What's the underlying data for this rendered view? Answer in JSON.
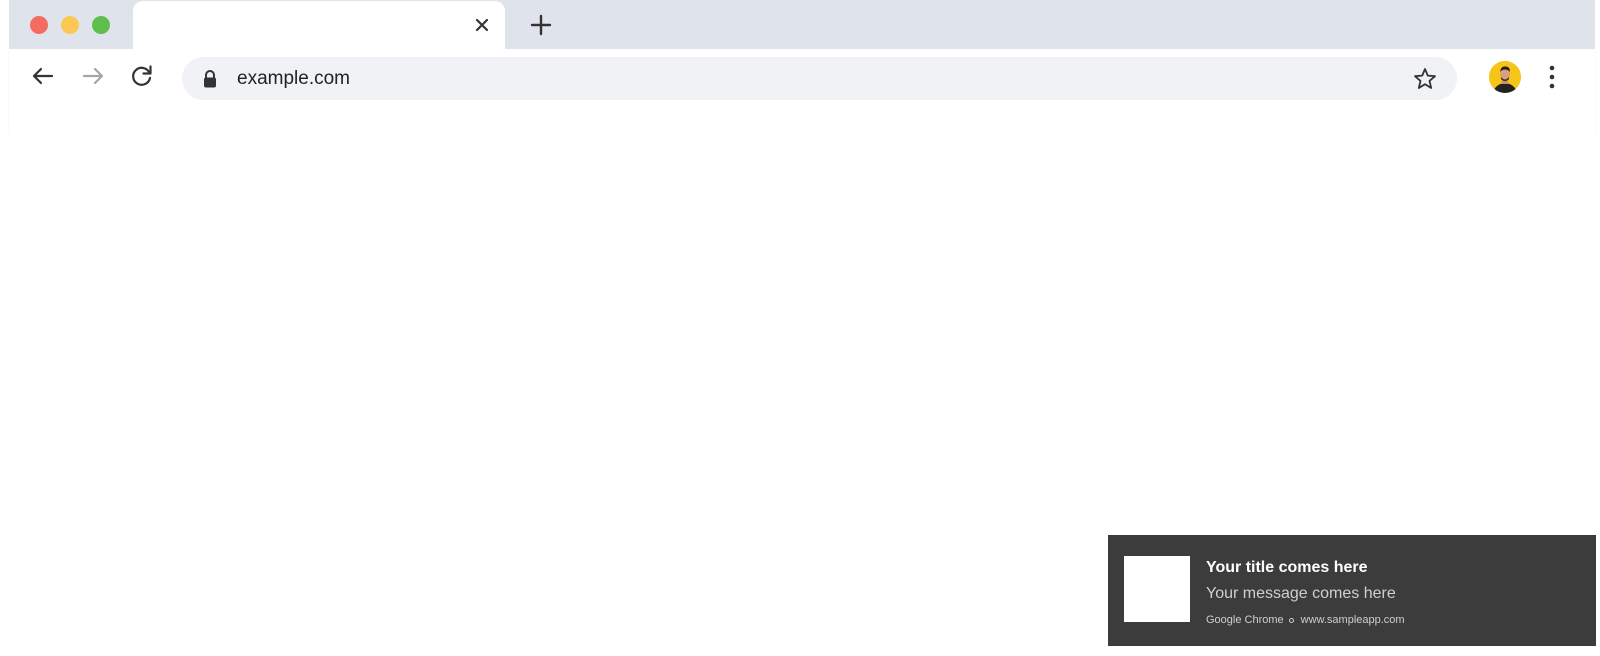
{
  "browser": {
    "url": "example.com",
    "accent": "#dfe3ec",
    "omnibox_bg": "#f0f2f6"
  },
  "window_controls": [
    {
      "name": "close",
      "color": "#f46b62"
    },
    {
      "name": "minimize",
      "color": "#fbc853"
    },
    {
      "name": "zoom",
      "color": "#5ebf4f"
    }
  ],
  "icons": {
    "tab_close": "close-icon",
    "new_tab": "plus-icon",
    "back": "arrow-left-icon",
    "forward": "arrow-right-icon",
    "reload": "reload-icon",
    "lock": "lock-icon",
    "bookmark": "star-icon",
    "profile": "avatar",
    "menu": "more-vertical-icon"
  },
  "notification": {
    "title": "Your title comes here",
    "message": "Your message comes here",
    "source": "Google Chrome",
    "site": "www.sampleapp.com",
    "bg_color": "#3c3c3c"
  }
}
